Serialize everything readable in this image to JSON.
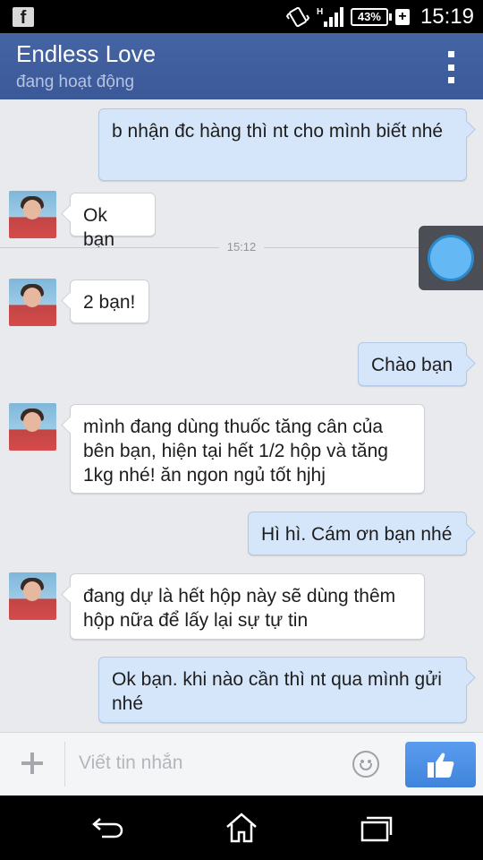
{
  "status_bar": {
    "notification_icon": "facebook-icon",
    "battery": "43%",
    "time": "15:19",
    "network": "H"
  },
  "header": {
    "title": "Endless Love",
    "subtitle": "đang hoạt động",
    "menu_icon": "overflow-menu-icon"
  },
  "messages": [
    {
      "direction": "out",
      "text": "b nhận đc hàng thì nt cho mình biết nhé"
    },
    {
      "direction": "in",
      "text": "Ok bạn"
    },
    {
      "type": "divider",
      "text": "15:12"
    },
    {
      "direction": "in",
      "text": "2 bạn!"
    },
    {
      "direction": "out",
      "text": "Chào bạn"
    },
    {
      "direction": "in",
      "text": "mình đang dùng thuốc tăng cân của bên bạn, hiện tại hết 1/2 hộp và tăng 1kg nhé! ăn ngon ngủ tốt hjhj"
    },
    {
      "direction": "out",
      "text": "Hì hì. Cám ơn bạn nhé"
    },
    {
      "direction": "in",
      "text": "đang dự là hết hộp này sẽ dùng thêm hộp nữa để lấy lại sự tự tin"
    },
    {
      "direction": "out",
      "text": "Ok bạn. khi nào cần thì nt qua mình gửi nhé"
    }
  ],
  "composer": {
    "placeholder": "Viết tin nhắn",
    "value": "",
    "add_icon": "plus-icon",
    "emoji_icon": "smiley-icon",
    "like_icon": "thumbs-up-icon"
  },
  "nav_bar": {
    "back_icon": "back-icon",
    "home_icon": "home-icon",
    "recents_icon": "recent-apps-icon"
  },
  "colors": {
    "header": "#3b5998",
    "outgoing_bubble": "#d5e6fb",
    "incoming_bubble": "#ffffff",
    "chat_background": "#e9eaed",
    "like_button": "#4a8ee6"
  }
}
